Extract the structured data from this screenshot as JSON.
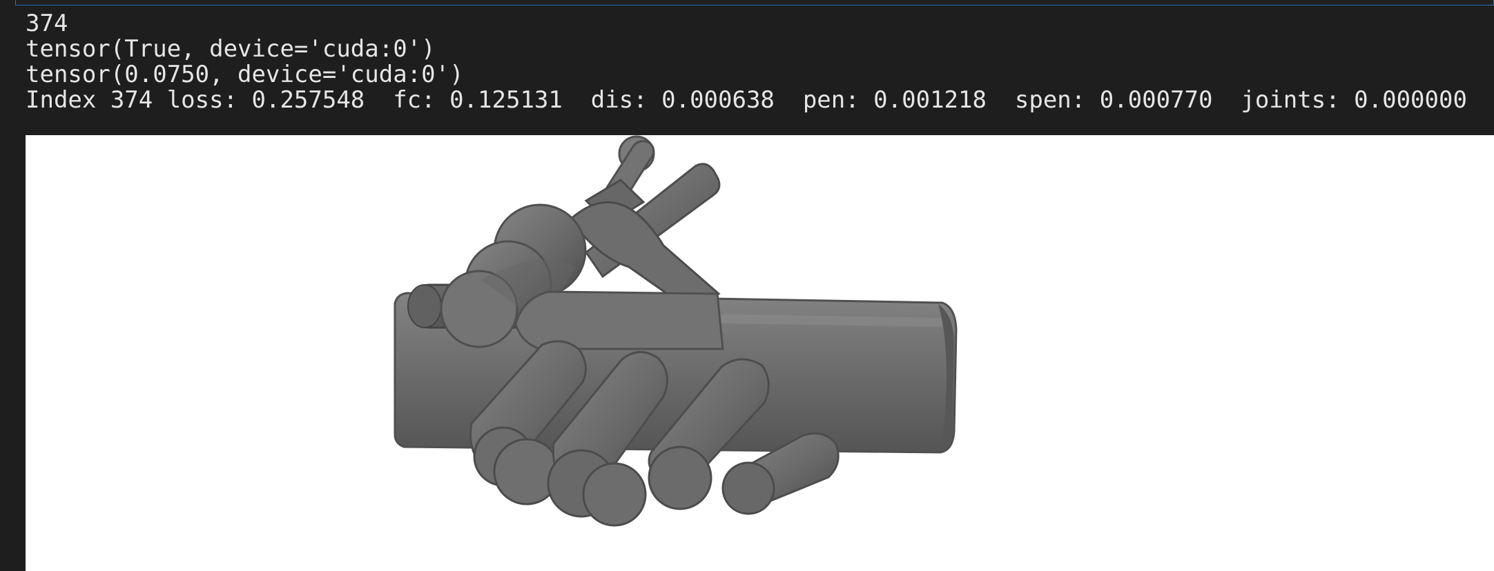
{
  "cell_output": {
    "lines": [
      "374",
      "tensor(True, device='cuda:0')",
      "tensor(0.0750, device='cuda:0')",
      "Index 374 loss: 0.257548  fc: 0.125131  dis: 0.000638  pen: 0.001218  spen: 0.000770  joints: 0.000000"
    ]
  },
  "render": {
    "background": "#ffffff",
    "hand_color": "#6d6d6d",
    "shadow_color": "#474747",
    "highlight_color": "#8a8a8a"
  }
}
